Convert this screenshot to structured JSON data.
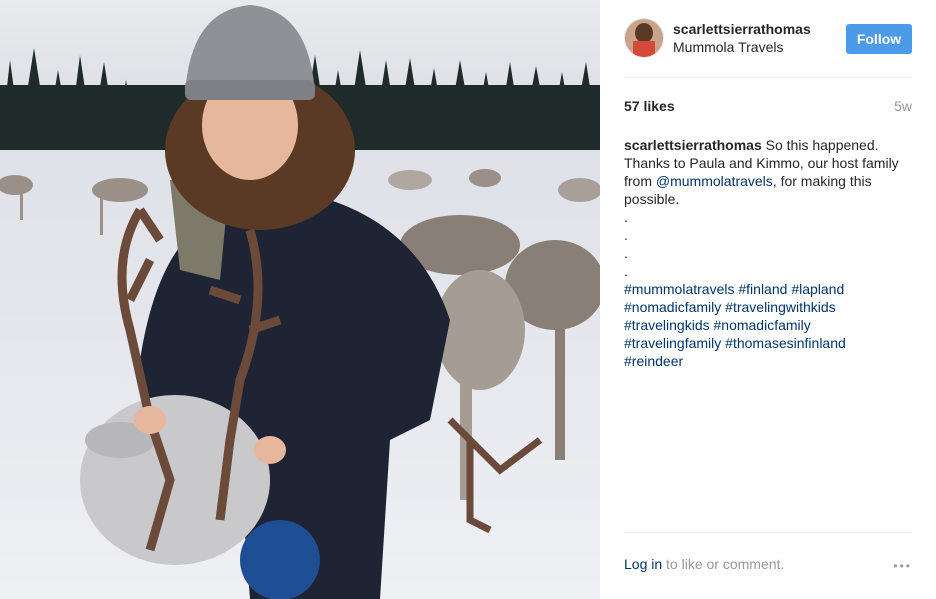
{
  "post": {
    "username": "scarlettsierrathomas",
    "location": "Mummola Travels",
    "follow_label": "Follow",
    "likes": "57 likes",
    "time_ago": "5w"
  },
  "caption": {
    "user": "scarlettsierrathomas",
    "text1": " So this happened. Thanks to Paula and Kimmo, our host family from ",
    "mention": "@mummolatravels",
    "text2": ", for making this possible.",
    "dots": [
      ".",
      ".",
      ".",
      "."
    ],
    "hashtags_lines": [
      [
        "#mummolatravels",
        "#finland",
        "#lapland"
      ],
      [
        "#nomadicfamily",
        "#travelingwithkids"
      ],
      [
        "#travelingkids",
        "#nomadicfamily"
      ],
      [
        "#travelingfamily",
        "#thomasesinfinland"
      ],
      [
        "#reindeer"
      ]
    ]
  },
  "footer": {
    "login_label": "Log in",
    "rest": " to like or comment.",
    "more_icon": "•••"
  },
  "icons": {
    "more": "more-options-icon"
  },
  "colors": {
    "follow": "#4c9be8",
    "link": "#003569",
    "muted": "#999999"
  }
}
